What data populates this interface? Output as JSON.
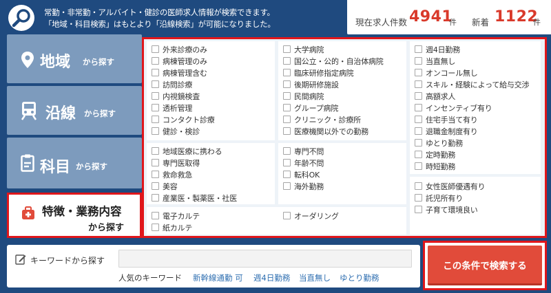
{
  "header": {
    "line1": "常勤・非常勤・アルバイト・健診の医師求人情報が検索できます。",
    "line2": "「地域・科目検索」はもとより「沿線検索」が可能になりました。",
    "count_label": "現在求人件数",
    "count_value": "4941",
    "count_unit": "件",
    "new_label": "新着",
    "new_value": "1122",
    "new_unit": "件"
  },
  "tabs": {
    "region": {
      "title": "地域",
      "sub": "から探す"
    },
    "line": {
      "title": "沿線",
      "sub": "から探す"
    },
    "subject": {
      "title": "科目",
      "sub": "から探す"
    },
    "feature": {
      "title": "特徴・業務内容",
      "sub": "から探す"
    }
  },
  "groups": {
    "g1": [
      "外来診療のみ",
      "病棟管理のみ",
      "病棟管理含む",
      "訪問診療",
      "内視鏡検査",
      "透析管理",
      "コンタクト診療",
      "健診・検診"
    ],
    "g2": [
      "大学病院",
      "国公立・公的・自治体病院",
      "臨床研修指定病院",
      "後期研修施設",
      "民間病院",
      "グループ病院",
      "クリニック・診療所",
      "医療機関以外での勤務"
    ],
    "g3": [
      "週4日勤務",
      "当直無し",
      "オンコール無し",
      "スキル・経験によって給与交渉",
      "高額求人",
      "インセンティブ有り",
      "住宅手当て有り",
      "退職金制度有り",
      "ゆとり勤務",
      "定時勤務",
      "時短勤務"
    ],
    "g4": [
      "地域医療に携わる",
      "専門医取得",
      "救命救急",
      "美容",
      "産業医・製薬医・社医"
    ],
    "g5": [
      "専門不問",
      "年齢不問",
      "転科OK",
      "海外勤務"
    ],
    "g6": [
      "女性医師優遇有り",
      "託児所有り",
      "子育て環境良い"
    ],
    "g7": [
      "電子カルテ",
      "紙カルテ"
    ],
    "g8": [
      "オーダリング"
    ]
  },
  "keyword": {
    "label": "キーワードから探す",
    "value": "",
    "popular_label": "人気のキーワード",
    "popular": [
      "新幹線通勤 可",
      "週4日勤務",
      "当直無し",
      "ゆとり勤務"
    ]
  },
  "search_button": "この条件で検索する",
  "colors": {
    "navy": "#1f4a7f",
    "tab": "#7d9bbd",
    "accent_red": "#e0161b",
    "count_red": "#d93a2b",
    "button": "#e14b3a",
    "link": "#2f6fb1"
  },
  "icons": {
    "header": "search-icon",
    "region": "map-pin-icon",
    "line": "train-icon",
    "subject": "clipboard-icon",
    "feature": "medical-bag-icon",
    "keyword": "pencil-icon"
  }
}
